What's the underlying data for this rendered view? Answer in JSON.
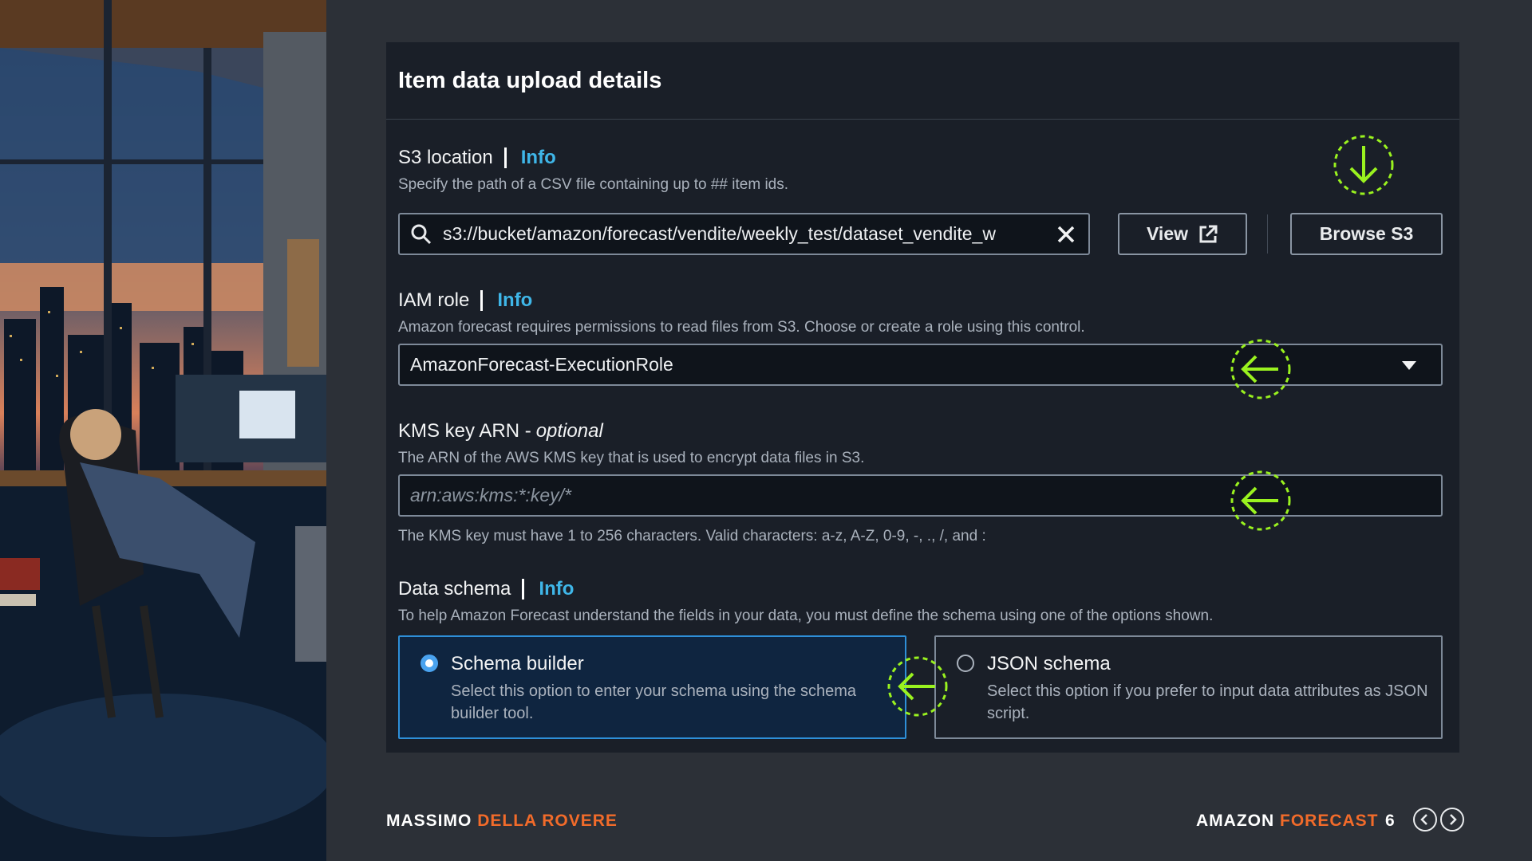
{
  "card": {
    "title": "Item data upload details"
  },
  "s3": {
    "label": "S3 location",
    "info": "Info",
    "description": "Specify the path of a CSV file containing up to ## item ids.",
    "value": "s3://bucket/amazon/forecast/vendite/weekly_test/dataset_vendite_w",
    "view_label": "View",
    "browse_label": "Browse S3"
  },
  "iam": {
    "label": "IAM role",
    "info": "Info",
    "description": "Amazon forecast requires permissions to read files from S3. Choose or create a role using this control.",
    "selected": "AmazonForecast-ExecutionRole"
  },
  "kms": {
    "label": "KMS key ARN -",
    "optional": "optional",
    "description": "The ARN of the AWS KMS key that is used to encrypt data files in S3.",
    "placeholder": "arn:aws:kms:*:key/*",
    "constraint": "The KMS key must have 1 to 256 characters. Valid characters: a-z, A-Z, 0-9, -, ., /, and :"
  },
  "schema": {
    "label": "Data schema",
    "info": "Info",
    "description": "To help Amazon Forecast understand the fields in your data, you must define the schema using one of the options shown.",
    "options": [
      {
        "title": "Schema builder",
        "description": "Select this option to enter your schema using the schema builder tool.",
        "selected": true
      },
      {
        "title": "JSON schema",
        "description": "Select this option if you prefer to input data attributes as JSON script.",
        "selected": false
      }
    ]
  },
  "footer": {
    "author_first": "MASSIMO",
    "author_last": "DELLA ROVERE",
    "product_first": "AMAZON",
    "product_last": "FORECAST",
    "page": "6"
  },
  "colors": {
    "accent_link": "#3fb6e8",
    "marker": "#9af21f",
    "brand_orange": "#f26b2a",
    "selected_border": "#2e8fd8"
  }
}
